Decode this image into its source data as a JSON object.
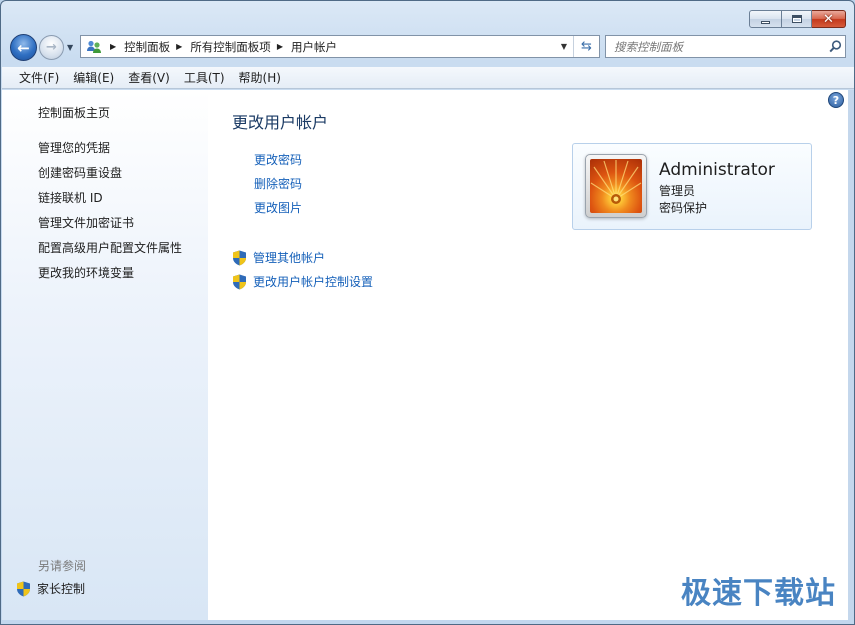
{
  "window": {
    "caption": {
      "minimize": "minimize",
      "maximize": "maximize",
      "close": "close"
    }
  },
  "nav": {
    "breadcrumbs": [
      "控制面板",
      "所有控制面板项",
      "用户帐户"
    ],
    "search_placeholder": "搜索控制面板"
  },
  "menu": [
    "文件(F)",
    "编辑(E)",
    "查看(V)",
    "工具(T)",
    "帮助(H)"
  ],
  "sidebar": {
    "home": "控制面板主页",
    "links": [
      "管理您的凭据",
      "创建密码重设盘",
      "链接联机 ID",
      "管理文件加密证书",
      "配置高级用户配置文件属性",
      "更改我的环境变量"
    ],
    "see_also_title": "另请参阅",
    "see_also_links": [
      "家长控制"
    ]
  },
  "main": {
    "title": "更改用户帐户",
    "actions": [
      "更改密码",
      "删除密码",
      "更改图片"
    ],
    "admin_actions": [
      "管理其他帐户",
      "更改用户帐户控制设置"
    ]
  },
  "user": {
    "name": "Administrator",
    "role": "管理员",
    "password_status": "密码保护"
  },
  "watermark": "极速下载站",
  "colors": {
    "link": "#1560b9",
    "title": "#1a3a64",
    "watermark": "#2a6fb8"
  },
  "icons": {
    "back": "back-arrow-icon",
    "forward": "forward-arrow-icon",
    "users": "users-icon",
    "refresh": "refresh-icon",
    "search": "search-icon",
    "help": "help-icon",
    "shield": "uac-shield-icon"
  }
}
